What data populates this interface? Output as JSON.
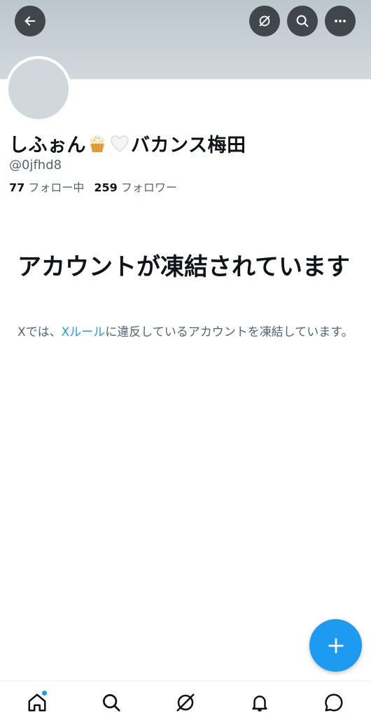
{
  "profile": {
    "name_part1": "しふぉん",
    "name_part2": "バカンス梅田",
    "handle": "@0jfhd8",
    "following_count": "77",
    "following_label": "フォロー中",
    "followers_count": "259",
    "followers_label": "フォロワー"
  },
  "notice": {
    "title": "アカウントが凍結されています",
    "body_prefix": "Xでは、",
    "rules_link": "Xルール",
    "body_suffix": "に違反しているアカウントを凍結しています。"
  },
  "icons": {
    "back": "arrow-left-icon",
    "grok": "grok-icon",
    "search": "search-icon",
    "more": "more-icon",
    "compose": "plus-icon",
    "emoji1": "cupcake-emoji",
    "emoji2": "white-heart-emoji"
  },
  "colors": {
    "accent": "#1d9bf0",
    "text": "#0f1419",
    "muted": "#536471"
  }
}
